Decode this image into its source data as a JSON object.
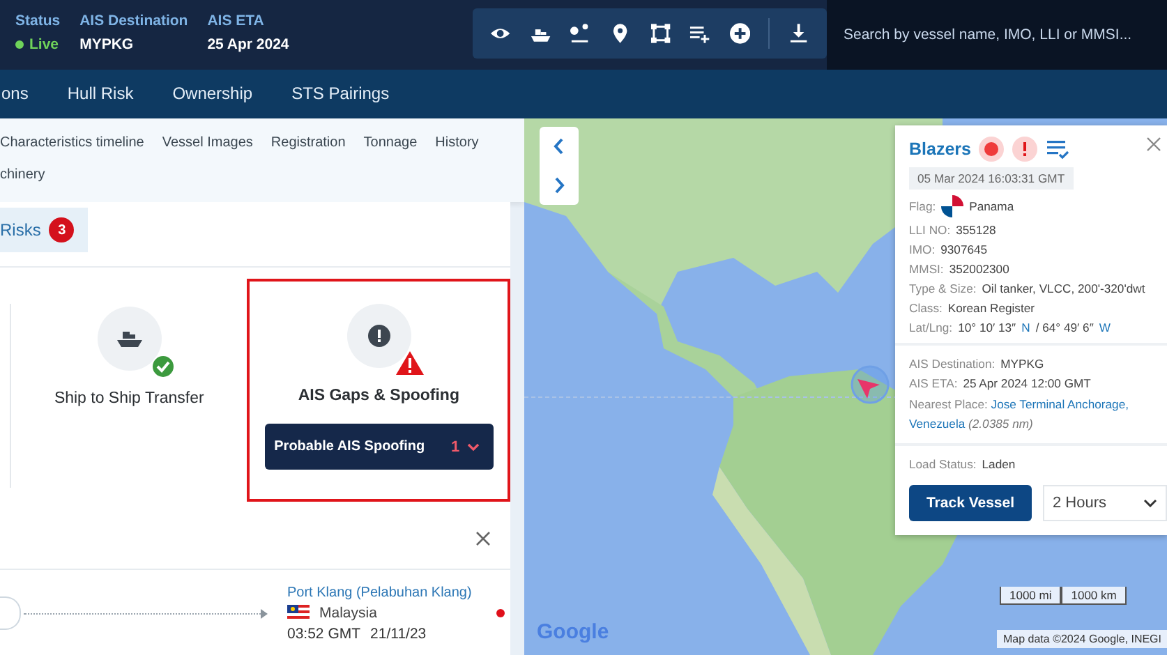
{
  "header": {
    "status": {
      "label": "Status",
      "value": "Live",
      "live": true
    },
    "destination": {
      "label": "AIS Destination",
      "value": "MYPKG"
    },
    "eta": {
      "label": "AIS ETA",
      "value": "25 Apr 2024"
    }
  },
  "search": {
    "placeholder": "Search by vessel name, IMO, LLI or MMSI..."
  },
  "nav_tabs": [
    {
      "label": "ons",
      "selected": false
    },
    {
      "label": "Hull Risk",
      "selected": false
    },
    {
      "label": "Ownership",
      "selected": false
    },
    {
      "label": "STS Pairings",
      "selected": false
    }
  ],
  "sub_tabs": [
    [
      "Characteristics timeline",
      "Vessel Images",
      "Registration",
      "Tonnage",
      "History"
    ],
    [
      "chinery"
    ]
  ],
  "risk_tab": {
    "label": "Risks",
    "count": "3",
    "selected": true
  },
  "risk_cards": [
    {
      "title": "Ship to Ship Transfer",
      "kind": "ok",
      "highlighted": false
    },
    {
      "title": "AIS Gaps & Spoofing",
      "kind": "alert",
      "highlighted": true,
      "finding": {
        "label": "Probable AIS Spoofing",
        "count": "1"
      }
    }
  ],
  "voyage": {
    "port": "Port Klang (Pelabuhan Klang)",
    "country": "Malaysia",
    "time": "03:52 GMT",
    "date": "21/11/23"
  },
  "map": {
    "popup": {
      "name": "Blazers",
      "timestamp": "05 Mar 2024 16:03:31 GMT",
      "fields": [
        {
          "label": "Flag:",
          "value": "Panama",
          "kind": "flag"
        },
        {
          "label": "LLI NO:",
          "value": "355128",
          "kind": "text"
        },
        {
          "label": "IMO:",
          "value": "9307645",
          "kind": "text"
        },
        {
          "label": "MMSI:",
          "value": "352002300",
          "kind": "text"
        },
        {
          "label": "Type & Size:",
          "value": "Oil tanker, VLCC, 200'-320'dwt",
          "kind": "text"
        },
        {
          "label": "Class:",
          "value": "Korean Register",
          "kind": "text"
        }
      ],
      "lat_lng": {
        "label": "Lat/Lng:",
        "parts": [
          {
            "text": "10° 10′ 13″",
            "kind": "plain"
          },
          {
            "text": "N",
            "kind": "dir"
          },
          {
            "text": "/ 64° 49′ 6″",
            "kind": "plain"
          },
          {
            "text": "W",
            "kind": "dir"
          }
        ]
      },
      "voyage_fields": [
        {
          "label": "AIS Destination:",
          "value": "MYPKG"
        },
        {
          "label": "AIS ETA:",
          "value": "25 Apr 2024 12:00 GMT"
        }
      ],
      "nearest_place": {
        "label": "Nearest Place:",
        "link": "Jose Terminal Anchorage, Venezuela",
        "distance": "(2.0385 nm)"
      },
      "load_status": {
        "label": "Load Status:",
        "value": "Laden"
      },
      "track_button": "Track Vessel",
      "duration": "2 Hours"
    },
    "scale": [
      "1000 mi",
      "1000 km"
    ],
    "logo": "Google",
    "attribution": "Map data ©2024 Google, INEGI"
  }
}
